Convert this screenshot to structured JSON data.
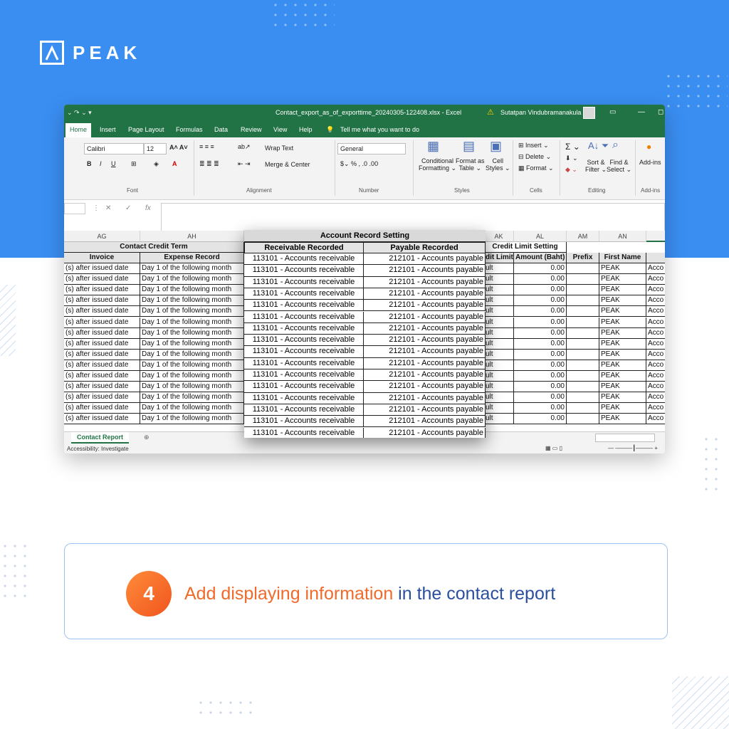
{
  "brand": {
    "logo_text": "PEAK"
  },
  "excel": {
    "quick_access": "⌄ ↷ ⌄ ▾",
    "file_title": "Contact_export_as_of_exporttime_20240305-122408.xlsx  -  Excel",
    "user_name": "Sutatpan Vindubramanakula",
    "tabs": [
      "Home",
      "Insert",
      "Page Layout",
      "Formulas",
      "Data",
      "Review",
      "View",
      "Help"
    ],
    "tell_me": "Tell me what you want to do",
    "ribbon": {
      "font_name": "Calibri",
      "font_size": "12",
      "wrap_text": "Wrap Text",
      "merge_center": "Merge & Center",
      "number_format": "General",
      "conditional_formatting": [
        "Conditional",
        "Formatting ⌄"
      ],
      "format_as_table": [
        "Format as",
        "Table ⌄"
      ],
      "cell_styles": [
        "Cell",
        "Styles ⌄"
      ],
      "insert": "Insert",
      "delete": "Delete",
      "format": "Format",
      "sort_filter": [
        "Sort &",
        "Filter ⌄"
      ],
      "find_select": [
        "Find &",
        "Select ⌄"
      ],
      "add_ins": "Add-ins",
      "groups": {
        "font": "Font",
        "alignment": "Alignment",
        "number": "Number",
        "styles": "Styles",
        "cells": "Cells",
        "editing": "Editing",
        "addins": "Add-ins"
      }
    },
    "formula_symbol": "fx",
    "columns": [
      "AG",
      "AH",
      "AK",
      "AL",
      "AM",
      "AN"
    ],
    "group_headers": {
      "contact_credit_term": "Contact Credit Term",
      "credit_limit_setting": "Credit Limit Setting"
    },
    "field_headers": {
      "invoice": "Invoice",
      "expense_record": "Expense Record",
      "credit_limit": "dit Limit",
      "amount": "Amount (Baht)",
      "prefix": "Prefix",
      "first_name": "First Name"
    },
    "row_values": {
      "invoice": "(s) after issued date",
      "expense": "Day 1 of the following month",
      "limit": "ult",
      "amount": "0.00",
      "first_name": "PEAK",
      "next": "Acco"
    },
    "sheet_tab": "Contact Report",
    "status_text": "Accessibility: Investigate"
  },
  "overlay": {
    "title": "Account Record Setting",
    "headers": [
      "Receivable Recorded",
      "Payable Recorded"
    ],
    "receivable": "113101 - Accounts receivable",
    "payable": "212101 - Accounts payable"
  },
  "step": {
    "number": "4",
    "text_orange": "Add displaying information",
    "text_blue": " in the contact report"
  },
  "colors": {
    "hero_blue": "#3a8ef2",
    "excel_green": "#217346",
    "accent_orange": "#f06a2b",
    "text_navy": "#2a4f9e"
  }
}
